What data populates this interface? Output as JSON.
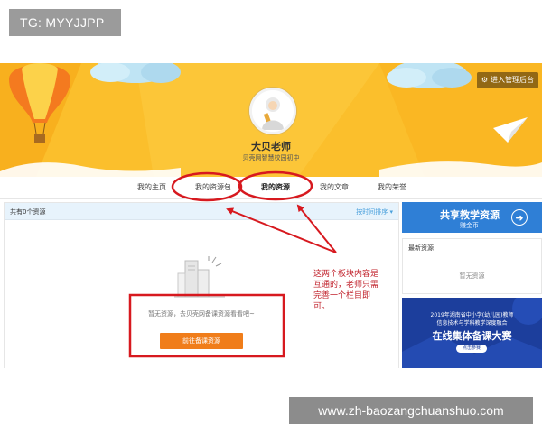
{
  "tg_badge": "TG: MYYJJPP",
  "header": {
    "admin_button": "进入管理后台",
    "teacher_name": "大贝老师",
    "school_name": "贝壳网智慧校园初中"
  },
  "nav": {
    "items": [
      {
        "label": "我的主页"
      },
      {
        "label": "我的资源包"
      },
      {
        "label": "我的资源"
      },
      {
        "label": "我的文章"
      },
      {
        "label": "我的荣誉"
      }
    ],
    "active_index": 2
  },
  "resource_panel": {
    "count_label": "共有0个资源",
    "sort_label": "按时间排序 ▾",
    "empty_text": "暂无资源，去贝壳网备课资源看看吧~",
    "goto_button": "前往备课资源"
  },
  "sidebar": {
    "share_title": "共享教学资源",
    "share_subtitle": "赚金币",
    "latest_title": "最新资源",
    "latest_empty": "暂无资源",
    "ad_line1": "2019年湖南省中小学(幼儿园)教师",
    "ad_line2": "信息技术与学科教学深度融合",
    "ad_line3": "在线集体备课大赛",
    "ad_button": "点击参赛"
  },
  "annotation_note": "这两个板块内容是互通的，老师只需完善一个栏目即可。",
  "watermark": "www.zh-baozangchuanshuo.com",
  "colors": {
    "banner": "#fbbf2c",
    "annotation_red": "#d7191f",
    "accent_orange": "#f07d1a",
    "accent_blue": "#2f7fd6",
    "ad_blue": "#1c3e9c"
  }
}
